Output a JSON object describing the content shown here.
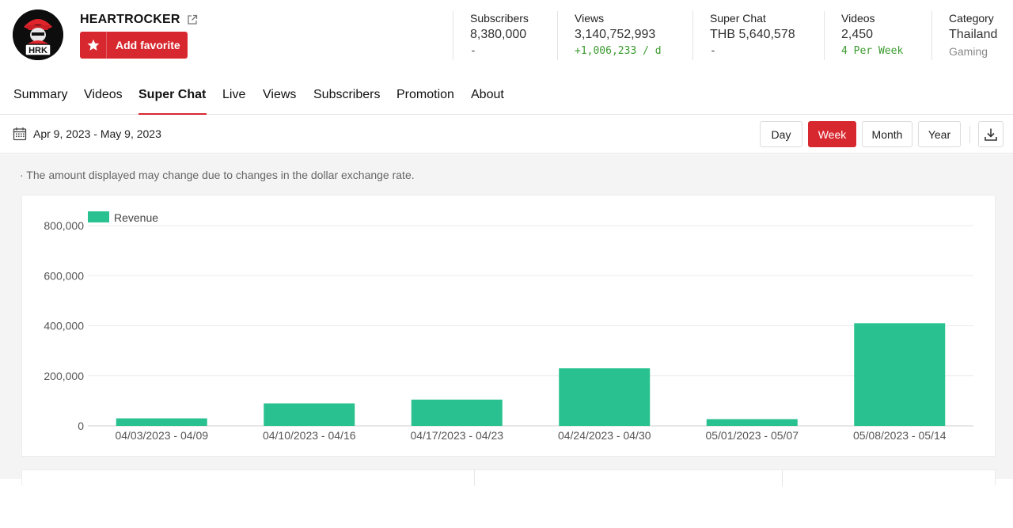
{
  "channel": {
    "name": "HEARTROCKER",
    "avatar_text": "HRK",
    "favorite_label": "Add favorite"
  },
  "stats": [
    {
      "key": "Subscribers",
      "value": "8,380,000",
      "sub": "-",
      "sub_style": "plain"
    },
    {
      "key": "Views",
      "value": "3,140,752,993",
      "sub": "+1,006,233 / d",
      "sub_style": "green"
    },
    {
      "key": "Super Chat",
      "value": "THB 5,640,578",
      "sub": "-",
      "sub_style": "plain"
    },
    {
      "key": "Videos",
      "value": "2,450",
      "sub": "4 Per Week",
      "sub_style": "green"
    },
    {
      "key": "Category",
      "value": "Thailand",
      "sub": "Gaming",
      "sub_style": "gray"
    }
  ],
  "tabs": [
    "Summary",
    "Videos",
    "Super Chat",
    "Live",
    "Views",
    "Subscribers",
    "Promotion",
    "About"
  ],
  "active_tab": "Super Chat",
  "toolbar": {
    "date_range": "Apr 9, 2023 - May 9, 2023",
    "periods": [
      "Day",
      "Week",
      "Month",
      "Year"
    ],
    "active_period": "Week"
  },
  "note": "· The amount displayed may change due to changes in the dollar exchange rate.",
  "colors": {
    "accent": "#d8282f",
    "bar": "#29c18f",
    "green_text": "#3b9b2f"
  },
  "chart_data": {
    "type": "bar",
    "categories": [
      "04/03/2023 - 04/09",
      "04/10/2023 - 04/16",
      "04/17/2023 - 04/23",
      "04/24/2023 - 04/30",
      "05/01/2023 - 05/07",
      "05/08/2023 - 05/14"
    ],
    "series": [
      {
        "name": "Revenue",
        "values": [
          30000,
          90000,
          105000,
          230000,
          27000,
          410000
        ]
      }
    ],
    "ylim": [
      0,
      800000
    ],
    "yticks": [
      "800,000",
      "600,000",
      "400,000",
      "200,000",
      "0"
    ],
    "ytick_values": [
      800000,
      600000,
      400000,
      200000,
      0
    ],
    "grid": true,
    "legend": "top-left"
  }
}
